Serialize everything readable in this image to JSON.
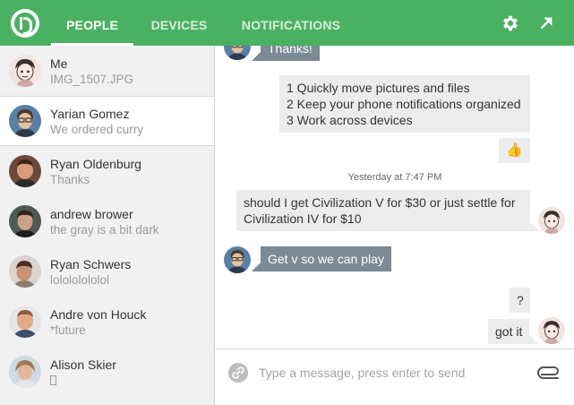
{
  "header": {
    "tabs": [
      {
        "label": "PEOPLE",
        "active": true
      },
      {
        "label": "DEVICES",
        "active": false
      },
      {
        "label": "NOTIFICATIONS",
        "active": false
      }
    ],
    "icons": [
      "pushbullet-logo-icon",
      "gear-icon",
      "popout-arrow-icon"
    ],
    "accent_color": "#4bb162"
  },
  "contacts": [
    {
      "name": "Me",
      "subtitle": "IMG_1507.JPG",
      "avatar": "cartoon-avatar"
    },
    {
      "name": "Yarian Gomez",
      "subtitle": "We ordered curry",
      "avatar": "photo-avatar",
      "selected": true
    },
    {
      "name": "Ryan Oldenburg",
      "subtitle": "Thanks",
      "avatar": "photo-avatar"
    },
    {
      "name": "andrew brower",
      "subtitle": "the gray is a bit dark",
      "avatar": "photo-avatar"
    },
    {
      "name": "Ryan Schwers",
      "subtitle": "lolololololol",
      "avatar": "photo-avatar"
    },
    {
      "name": "Andre von Houck",
      "subtitle": "*future",
      "avatar": "photo-avatar"
    },
    {
      "name": "Alison Skier",
      "subtitle": "",
      "avatar": "photo-avatar"
    }
  ],
  "messages": [
    {
      "direction": "in",
      "text": "Thanks!"
    },
    {
      "direction": "out",
      "lines": [
        "1 Quickly move pictures and files",
        "2 Keep your phone notifications organized",
        "3 Work across devices"
      ]
    },
    {
      "direction": "out",
      "text": "👍"
    },
    {
      "timestamp": "Yesterday at 7:47 PM"
    },
    {
      "direction": "out",
      "lines": [
        "should I get Civilization V for $30 or just settle for",
        "Civilization IV for $10"
      ]
    },
    {
      "direction": "in",
      "text": "Get v so we can play"
    },
    {
      "direction": "out",
      "text": "?"
    },
    {
      "direction": "out",
      "text": "got it"
    }
  ],
  "composer": {
    "placeholder": "Type a message, press enter to send",
    "value": ""
  }
}
